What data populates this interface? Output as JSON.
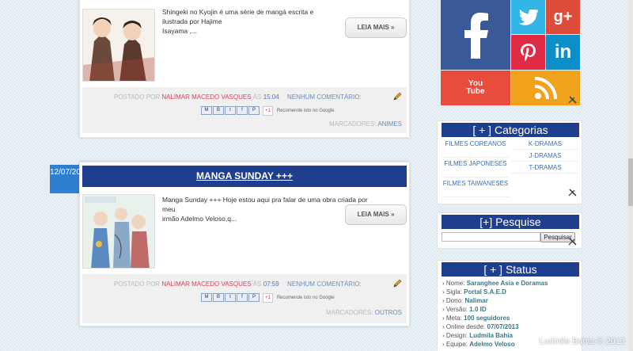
{
  "posts": [
    {
      "snippet_l1": "Shingeki no Kyojin        é uma série de mangá escrita e ilustrada por Hajime",
      "snippet_l2": "Isayama ,...",
      "read_more": "LEIA MAIS »",
      "posted_by_label": "POSTADO POR",
      "author": "NALIMAR MACEDO VASQUES",
      "at_label": "ÀS",
      "time": "15:04",
      "comments": "NENHUM COMENTÁRIO:",
      "recommend": "Recomende isto no Google",
      "labels_label": "MARCADORES:",
      "label": "ANIMES"
    },
    {
      "date": "12/07/2013",
      "title": "MANGA SUNDAY +++",
      "snippet_l1": "Manga Sunday +++   Hoje estou aqui pra falar de uma obra criada por meu",
      "snippet_l2": "irmão Adelmo Veloso,q...",
      "read_more": "LEIA MAIS »",
      "posted_by_label": "POSTADO POR",
      "author": "NALIMAR MACEDO VASQUES",
      "at_label": "ÀS",
      "time": "07:59",
      "comments": "NENHUM COMENTÁRIO:",
      "recommend": "Recomende isto no Google",
      "labels_label": "MARCADORES:",
      "label": "OUTROS"
    }
  ],
  "share_buttons": [
    "M",
    "B",
    "t",
    "f",
    "P"
  ],
  "gplus": "+1",
  "social_tiles": [
    "facebook-icon",
    "twitter-icon",
    "google-plus-icon",
    "pinterest-icon",
    "linkedin-icon",
    "youtube-icon",
    "rss-icon"
  ],
  "youtube_text": "You Tube",
  "categorias": {
    "title": "[ + ]  Categorias",
    "left": [
      "FILMES COREANOS",
      "FILMES JAPONESES",
      "FILMES TAIWANESES"
    ],
    "right": [
      "K-DRAMAS",
      "J-DRAMAS",
      "T-DRAMAS"
    ]
  },
  "pesquise": {
    "title": "[+]  Pesquise",
    "button": "Pesquisar",
    "value": ""
  },
  "status": {
    "title": "[ + ]  Status",
    "rows": [
      {
        "label": "Nome:",
        "value": "Saranghee Asia e Doramas"
      },
      {
        "label": "Sigla:",
        "value": "Portal S.A.E.D"
      },
      {
        "label": "Dono:",
        "value": "Nalimar"
      },
      {
        "label": "Versão:",
        "value": "1.0 ID"
      },
      {
        "label": "Meta:",
        "value": "100 seguidores"
      },
      {
        "label": "Online desde:",
        "value": "07/07/2013"
      },
      {
        "label": "Design:",
        "value": "Ludmila Bahia"
      },
      {
        "label": "Equipe:",
        "value": "Adelmo Veloso"
      }
    ]
  },
  "watermark": "Ludmila Bahia © 2013",
  "colors": {
    "facebook": "#3b5998",
    "twitter": "#33b5e5",
    "gplus": "#dd4b39",
    "pinterest": "#e02a46",
    "linkedin": "#0c8fc8",
    "youtube": "#e84c3d",
    "rss": "#f0a21d",
    "title_bar": "#1f3e8e"
  }
}
